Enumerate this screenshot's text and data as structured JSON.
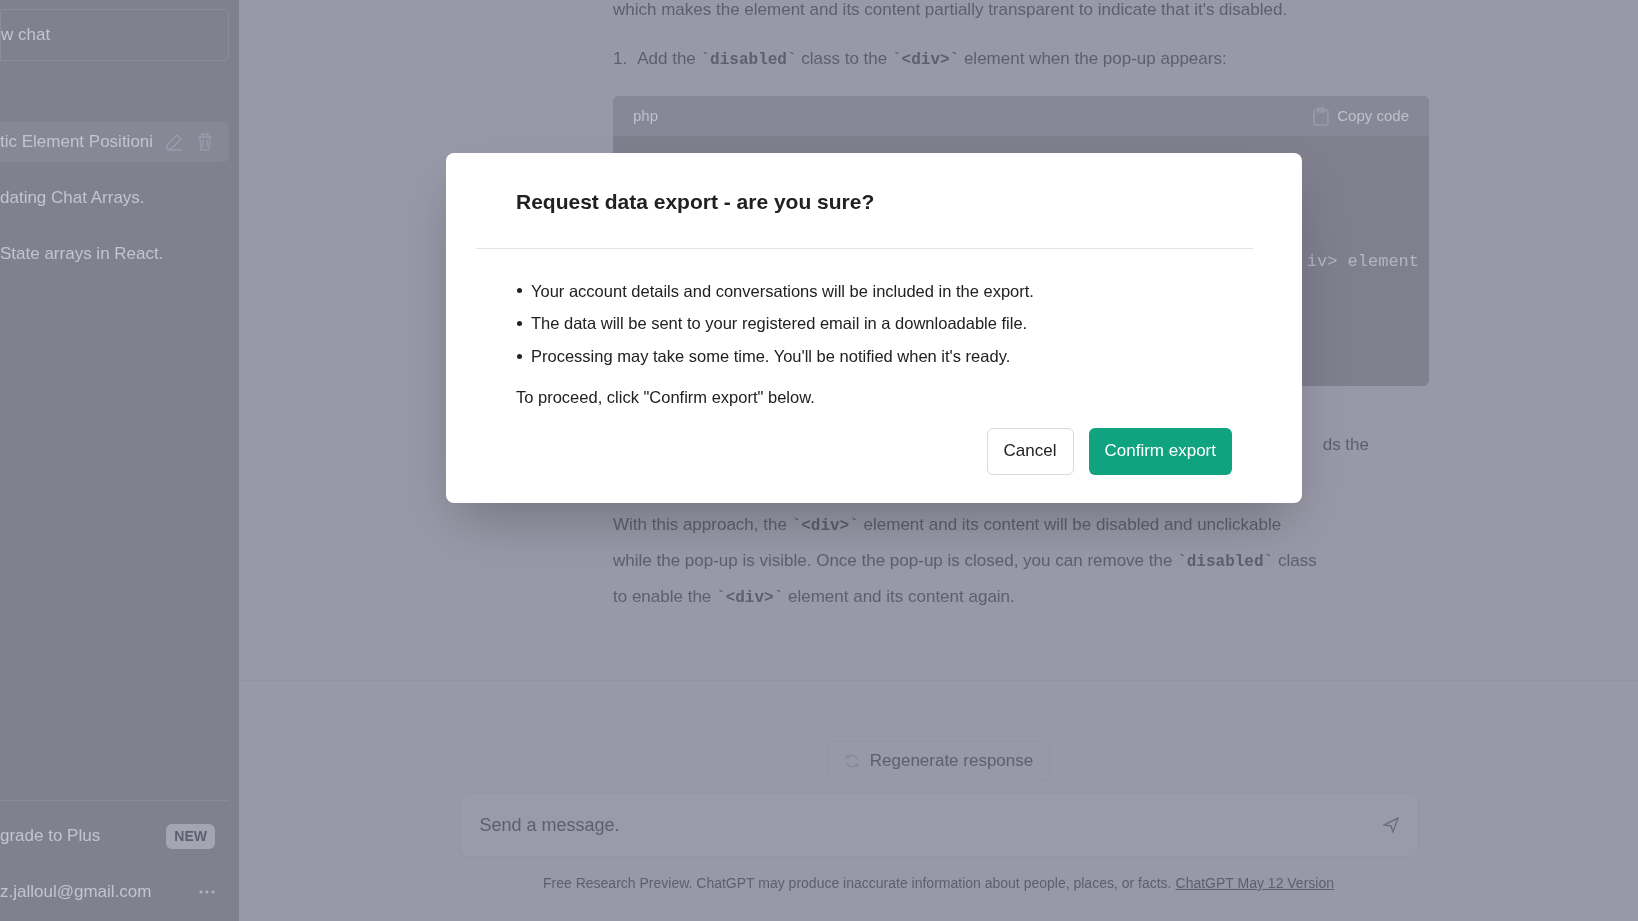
{
  "sidebar": {
    "new_chat": "w chat",
    "conversations": [
      {
        "title": "tic Element Positioni",
        "selected": true
      },
      {
        "title": "dating Chat Arrays.",
        "selected": false
      },
      {
        "title": "State arrays in React.",
        "selected": false
      }
    ],
    "upgrade": {
      "label": "grade to Plus",
      "badge": "NEW"
    },
    "account": {
      "email": "z.jalloul@gmail.com"
    }
  },
  "conversation": {
    "top_line": "which makes the element and its content partially transparent to indicate that it's disabled.",
    "step": {
      "number": "1.",
      "segments": [
        {
          "kind": "text",
          "text": "Add the "
        },
        {
          "kind": "code",
          "text": "`disabled`"
        },
        {
          "kind": "text",
          "text": " class to the "
        },
        {
          "kind": "code",
          "text": "`<div>`"
        },
        {
          "kind": "text",
          "text": " element when the pop-up appears:"
        }
      ]
    },
    "code_block": {
      "language": "php",
      "copy_label": "Copy code",
      "visible_code": "iv> element"
    },
    "partial_text": "ds the",
    "closing_lines": [
      [
        {
          "kind": "text",
          "text": "With this approach, the "
        },
        {
          "kind": "code",
          "text": "`<div>`"
        },
        {
          "kind": "text",
          "text": " element and its content will be disabled and unclickable"
        }
      ],
      [
        {
          "kind": "text",
          "text": "while the pop-up is visible. Once the pop-up is closed, you can remove the "
        },
        {
          "kind": "code",
          "text": "`disabled`"
        },
        {
          "kind": "text",
          "text": " class"
        }
      ],
      [
        {
          "kind": "text",
          "text": "to enable the "
        },
        {
          "kind": "code",
          "text": "`<div>`"
        },
        {
          "kind": "text",
          "text": " element and its content again."
        }
      ]
    ]
  },
  "composer": {
    "regenerate": "Regenerate response",
    "placeholder": "Send a message.",
    "footer": "Free Research Preview. ChatGPT may produce inaccurate information about people, places, or facts.",
    "footer_link": "ChatGPT May 12 Version"
  },
  "dialog": {
    "title": "Request data export - are you sure?",
    "bullets": [
      "Your account details and conversations will be included in the export.",
      "The data will be sent to your registered email in a downloadable file.",
      "Processing may take some time. You'll be notified when it's ready."
    ],
    "note": "To proceed, click \"Confirm export\" below.",
    "buttons": [
      {
        "kind": "secondary",
        "label": "Cancel"
      },
      {
        "kind": "primary",
        "label": "Confirm export"
      }
    ]
  }
}
